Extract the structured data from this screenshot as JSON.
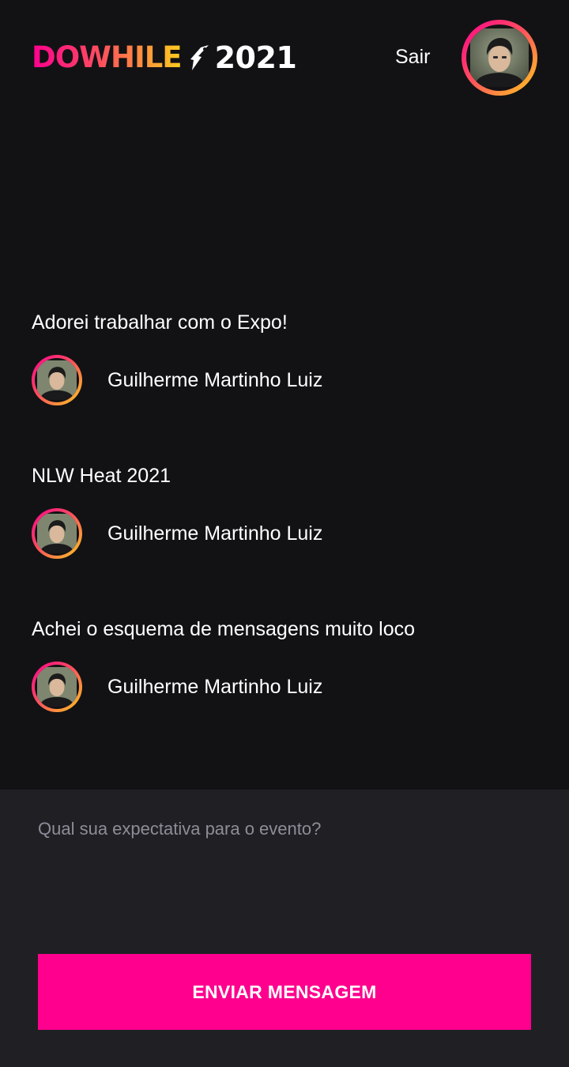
{
  "header": {
    "logo": {
      "brand": "DOWHILE",
      "year": "2021"
    },
    "sign_out_label": "Sair",
    "avatar_icon": "user-avatar-photo"
  },
  "messages": [
    {
      "content": "Adorei trabalhar com o Expo!",
      "user": {
        "name": "Guilherme Martinho Luiz"
      }
    },
    {
      "content": "NLW Heat 2021",
      "user": {
        "name": "Guilherme Martinho Luiz"
      }
    },
    {
      "content": "Achei o esquema de mensagens muito loco",
      "user": {
        "name": "Guilherme Martinho Luiz"
      }
    }
  ],
  "form": {
    "message_input": {
      "value": "",
      "placeholder": "Qual sua expectativa para o evento?"
    },
    "send_label": "ENVIAR MENSAGEM"
  },
  "colors": {
    "background": "#121214",
    "form_background": "#202024",
    "accent_pink": "#ff008e",
    "accent_yellow": "#ffcd1e",
    "text": "#ffffff",
    "placeholder": "#8d8d99"
  }
}
